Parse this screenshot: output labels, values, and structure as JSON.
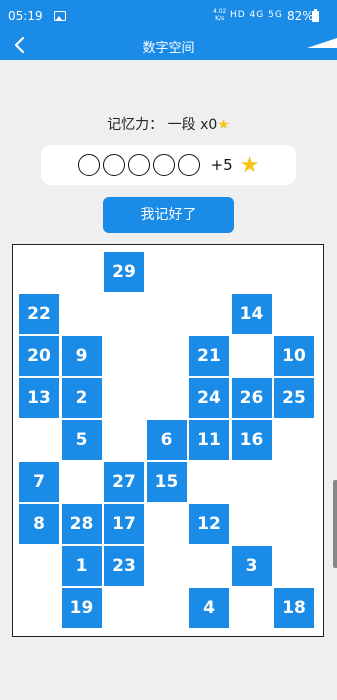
{
  "status": {
    "time": "05:19",
    "net_speed_value": "4.02",
    "net_speed_unit": "K/s",
    "icons_text": "HD 4G 5G",
    "battery_pct": "82%"
  },
  "header": {
    "title": "数字空间"
  },
  "memory": {
    "label": "记忆力：",
    "level": "一段",
    "multiplier": "x0"
  },
  "dots": {
    "count": 5,
    "bonus": "+5"
  },
  "button": {
    "label": "我记好了"
  },
  "tiles": [
    {
      "n": "29",
      "col": 2,
      "row": 0
    },
    {
      "n": "22",
      "col": 0,
      "row": 1
    },
    {
      "n": "14",
      "col": 5,
      "row": 1
    },
    {
      "n": "20",
      "col": 0,
      "row": 2
    },
    {
      "n": "9",
      "col": 1,
      "row": 2
    },
    {
      "n": "21",
      "col": 4,
      "row": 2
    },
    {
      "n": "10",
      "col": 6,
      "row": 2
    },
    {
      "n": "13",
      "col": 0,
      "row": 3
    },
    {
      "n": "2",
      "col": 1,
      "row": 3
    },
    {
      "n": "24",
      "col": 4,
      "row": 3
    },
    {
      "n": "26",
      "col": 5,
      "row": 3
    },
    {
      "n": "25",
      "col": 6,
      "row": 3
    },
    {
      "n": "5",
      "col": 1,
      "row": 4
    },
    {
      "n": "6",
      "col": 3,
      "row": 4
    },
    {
      "n": "11",
      "col": 4,
      "row": 4
    },
    {
      "n": "16",
      "col": 5,
      "row": 4
    },
    {
      "n": "7",
      "col": 0,
      "row": 5
    },
    {
      "n": "27",
      "col": 2,
      "row": 5
    },
    {
      "n": "15",
      "col": 3,
      "row": 5
    },
    {
      "n": "8",
      "col": 0,
      "row": 6
    },
    {
      "n": "28",
      "col": 1,
      "row": 6
    },
    {
      "n": "17",
      "col": 2,
      "row": 6
    },
    {
      "n": "12",
      "col": 4,
      "row": 6
    },
    {
      "n": "1",
      "col": 1,
      "row": 7
    },
    {
      "n": "23",
      "col": 2,
      "row": 7
    },
    {
      "n": "3",
      "col": 5,
      "row": 7
    },
    {
      "n": "19",
      "col": 1,
      "row": 8
    },
    {
      "n": "4",
      "col": 4,
      "row": 8
    },
    {
      "n": "18",
      "col": 6,
      "row": 8
    }
  ]
}
